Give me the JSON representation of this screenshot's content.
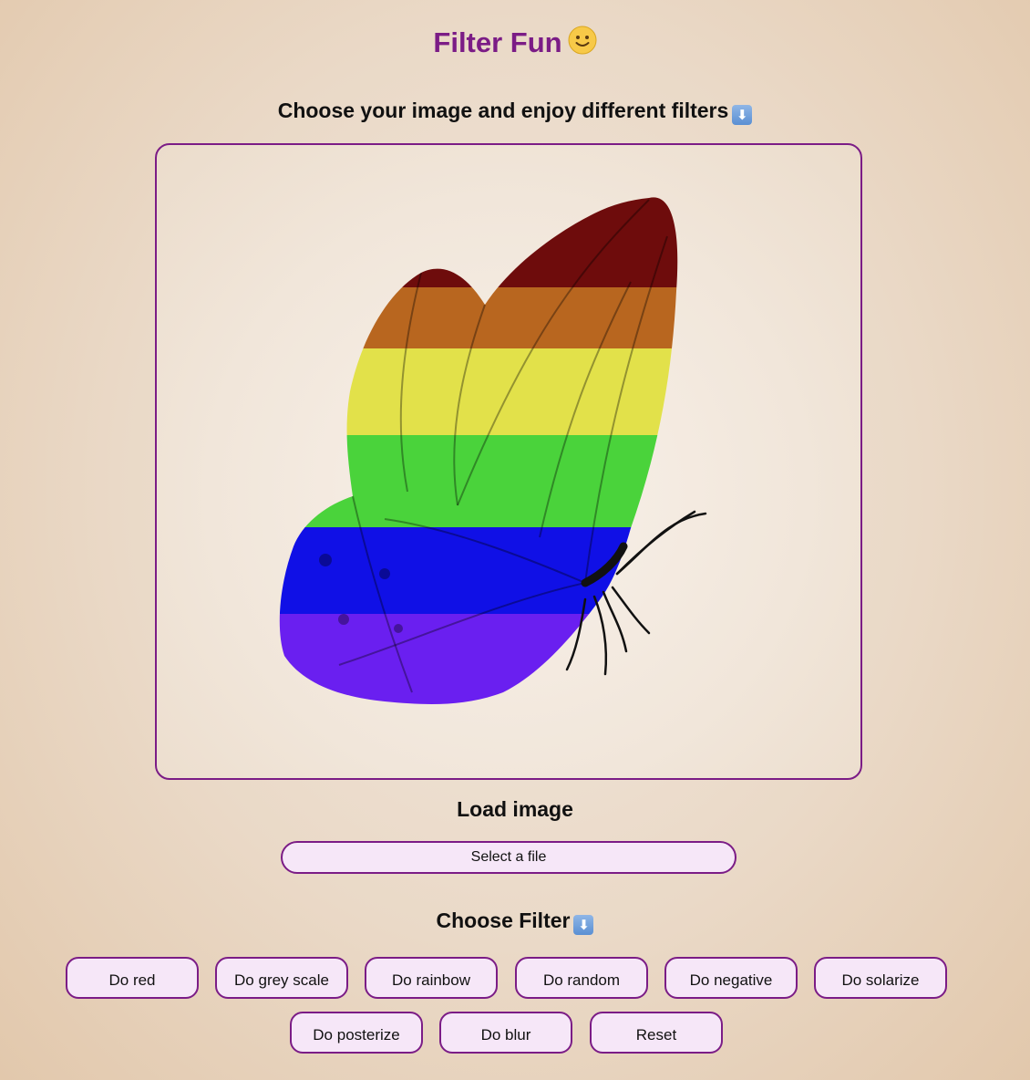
{
  "header": {
    "title": "Filter Fun",
    "title_emoji": "🙂",
    "subtitle": "Choose your image and enjoy different filters"
  },
  "canvas": {
    "image_subject": "butterfly-rainbow-filtered",
    "stripe_colors": [
      "#6e0c0c",
      "#b8661f",
      "#e2e14a",
      "#4ad33b",
      "#1010e6",
      "#6a1ff0"
    ]
  },
  "load": {
    "heading": "Load image",
    "file_button_label": "Select a file"
  },
  "filters": {
    "heading": "Choose Filter",
    "buttons": [
      "Do red",
      "Do grey scale",
      "Do rainbow",
      "Do random",
      "Do negative",
      "Do solarize",
      "Do posterize",
      "Do blur",
      "Reset"
    ]
  },
  "colors": {
    "accent": "#7b1c86",
    "button_bg": "#f6e7f8"
  }
}
